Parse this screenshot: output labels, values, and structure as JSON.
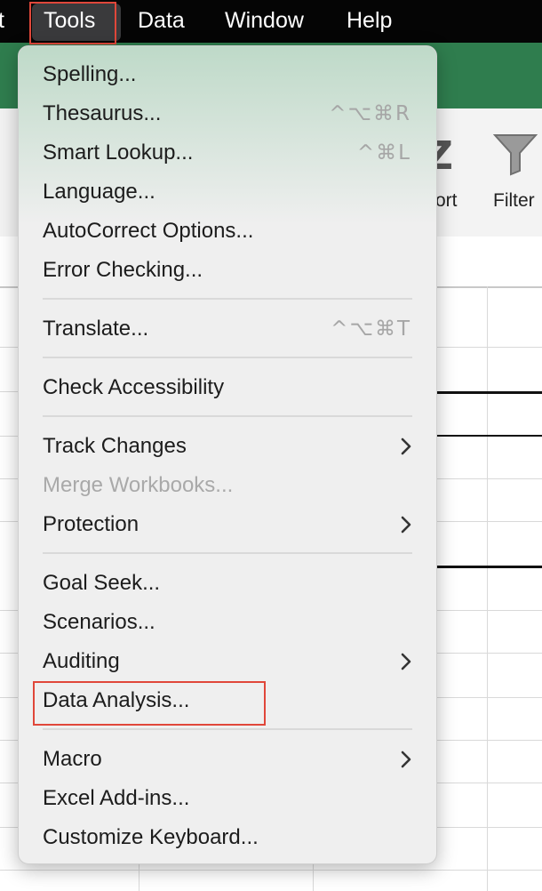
{
  "menubar": {
    "partial_item": "t",
    "items": [
      "Tools",
      "Data",
      "Window",
      "Help"
    ],
    "active": "Tools"
  },
  "ribbon": {
    "sort_label": "ort",
    "filter_label": "Filter",
    "sort_glyph": "Z"
  },
  "tools_menu": {
    "items": [
      {
        "label": "Spelling...",
        "shortcut": ""
      },
      {
        "label": "Thesaurus...",
        "shortcut": "^⌥⌘R"
      },
      {
        "label": "Smart Lookup...",
        "shortcut": "^⌘L"
      },
      {
        "label": "Language...",
        "shortcut": ""
      },
      {
        "label": "AutoCorrect Options...",
        "shortcut": ""
      },
      {
        "label": "Error Checking...",
        "shortcut": ""
      },
      {
        "label": "Translate...",
        "shortcut": "^⌥⌘T"
      },
      {
        "label": "Check Accessibility",
        "shortcut": ""
      },
      {
        "label": "Track Changes",
        "submenu": true
      },
      {
        "label": "Merge Workbooks...",
        "disabled": true
      },
      {
        "label": "Protection",
        "submenu": true
      },
      {
        "label": "Goal Seek...",
        "shortcut": ""
      },
      {
        "label": "Scenarios...",
        "shortcut": ""
      },
      {
        "label": "Auditing",
        "submenu": true
      },
      {
        "label": "Data Analysis...",
        "highlighted": true
      },
      {
        "label": "Macro",
        "submenu": true
      },
      {
        "label": "Excel Add-ins...",
        "shortcut": ""
      },
      {
        "label": "Customize Keyboard...",
        "shortcut": ""
      }
    ]
  },
  "colors": {
    "highlight_box": "#e0473a",
    "menu_bg": "#efefef",
    "menubar_bg": "#050505",
    "ribbon_green": "#2f7d4e"
  }
}
